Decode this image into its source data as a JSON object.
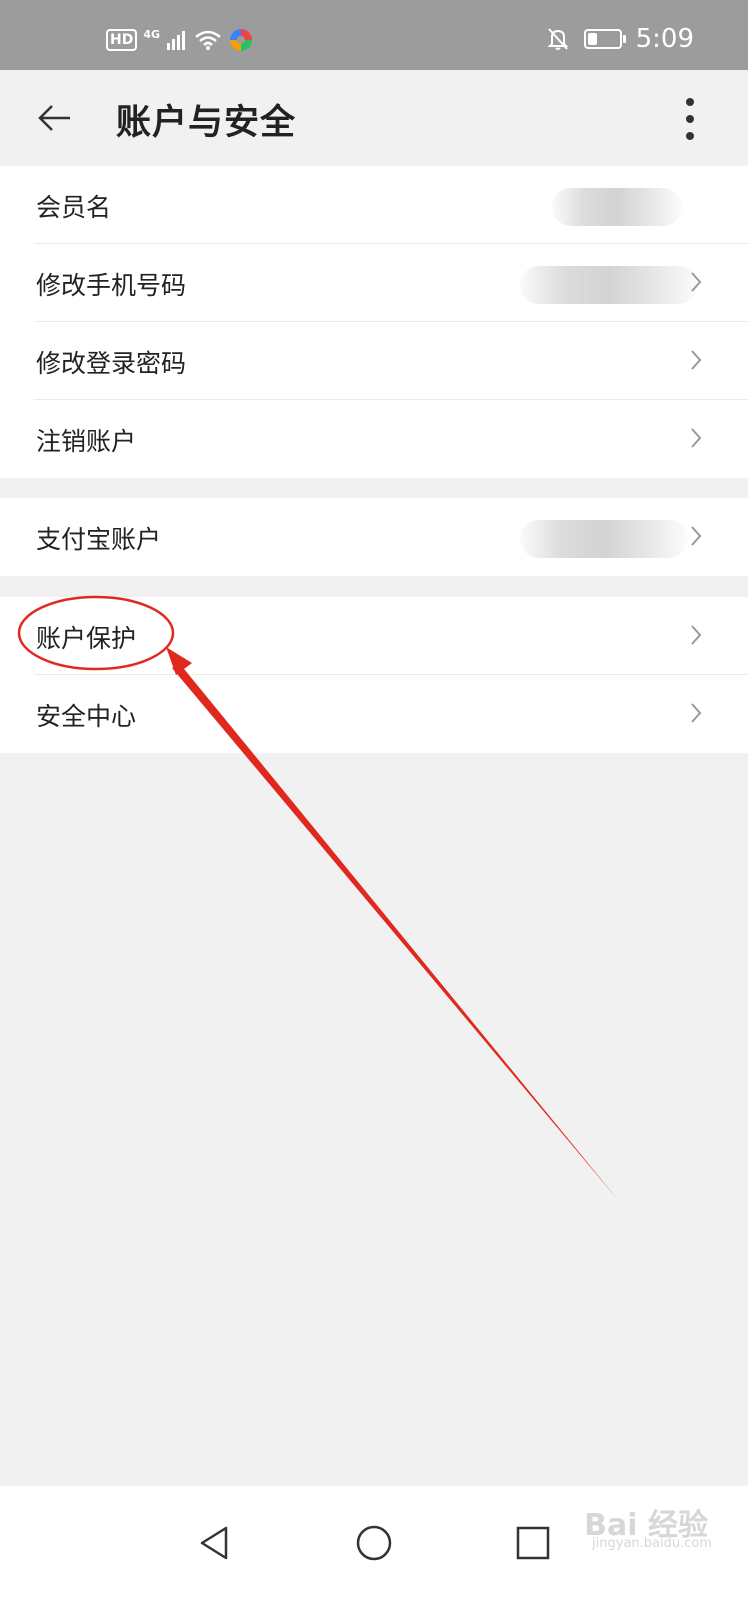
{
  "status_bar": {
    "hd": "HD",
    "network": "4G",
    "time": "5:09",
    "battery_level": 0.3,
    "icons": [
      "hd-icon",
      "signal-icon",
      "wifi-icon",
      "app-notify-icon",
      "mute-bell-icon",
      "battery-icon"
    ]
  },
  "app_bar": {
    "title": "账户与安全",
    "back_icon": "arrow-left-icon",
    "more_icon": "vertical-dots-icon"
  },
  "sections": [
    {
      "rows": [
        {
          "label": "会员名"
        },
        {
          "label": "修改手机号码"
        },
        {
          "label": "修改登录密码"
        },
        {
          "label": "注销账户"
        }
      ]
    },
    {
      "rows": [
        {
          "label": "支付宝账户"
        }
      ]
    },
    {
      "rows": [
        {
          "label": "账户保护"
        },
        {
          "label": "安全中心"
        }
      ]
    }
  ],
  "annotation": {
    "color": "#e0281e",
    "highlighted_item": "账户保护"
  },
  "nav_bar": {
    "icons": [
      "triangle-back-icon",
      "circle-home-icon",
      "square-recents-icon"
    ]
  },
  "watermark": {
    "text": "Bai 经验",
    "sub": "jingyan.baidu.com"
  }
}
